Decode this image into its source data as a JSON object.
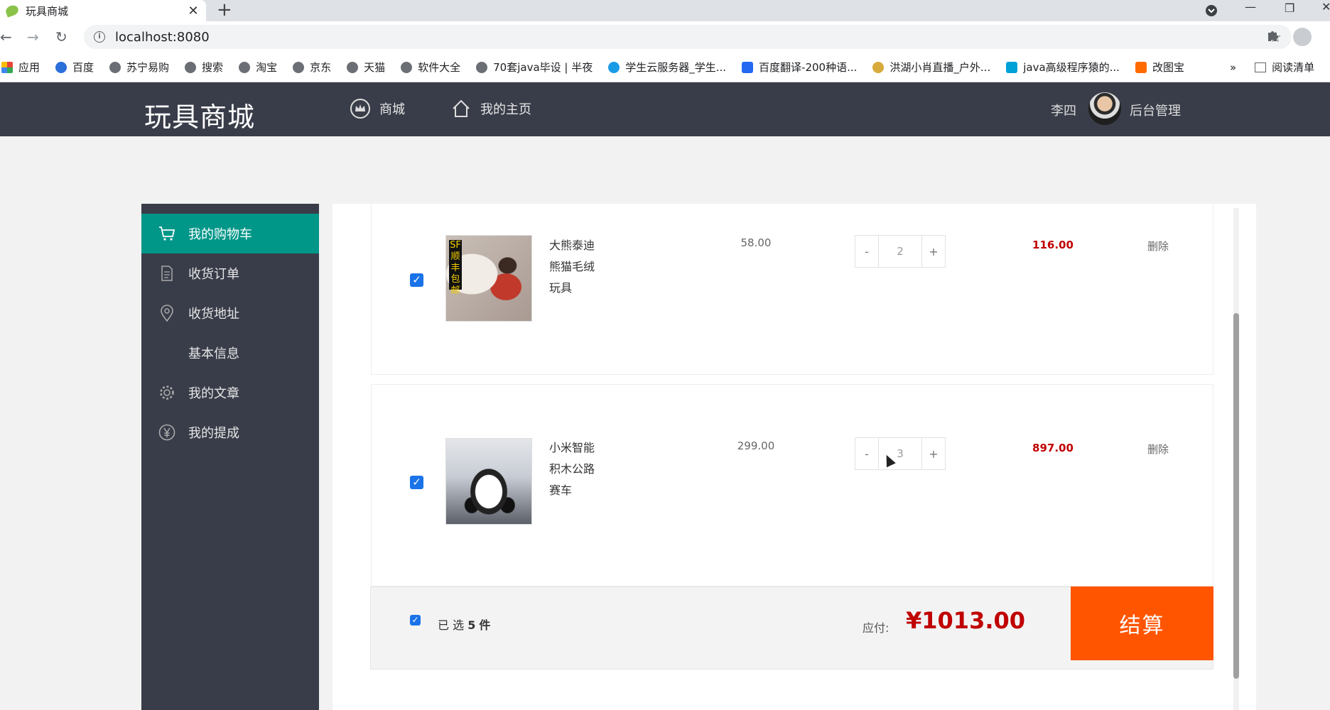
{
  "browser": {
    "tab_title": "玩具商城",
    "tab_close": "✕",
    "new_tab": "+",
    "url": "localhost:8080",
    "nav": {
      "back": "←",
      "forward": "→",
      "reload": "↻"
    },
    "star": "☆",
    "bookmarks": [
      {
        "label": "应用",
        "icon": "apps-grid-icon"
      },
      {
        "label": "百度",
        "icon": "baidu-paw-icon"
      },
      {
        "label": "苏宁易购",
        "icon": "globe-icon"
      },
      {
        "label": "搜索",
        "icon": "globe-icon"
      },
      {
        "label": "淘宝",
        "icon": "globe-icon"
      },
      {
        "label": "京东",
        "icon": "globe-icon"
      },
      {
        "label": "天猫",
        "icon": "globe-icon"
      },
      {
        "label": "软件大全",
        "icon": "globe-icon"
      },
      {
        "label": "70套java毕设 | 半夜",
        "icon": "globe-icon"
      },
      {
        "label": "学生云服务器_学生...",
        "icon": "cloud-icon"
      },
      {
        "label": "百度翻译-200种语...",
        "icon": "translate-icon"
      },
      {
        "label": "洪湖小肖直播_户外...",
        "icon": "feather-icon"
      },
      {
        "label": "java高级程序猿的...",
        "icon": "tv-icon"
      },
      {
        "label": "改图宝",
        "icon": "orange-square-icon"
      }
    ],
    "bookmarks_more": "»",
    "reading_list": "阅读清单"
  },
  "site": {
    "logo": "玩具商城",
    "nav": [
      {
        "label": "商城",
        "icon": "crown-icon"
      },
      {
        "label": "我的主页",
        "icon": "home-icon"
      }
    ],
    "user_name": "李四",
    "admin_link": "后台管理"
  },
  "side_menu": [
    {
      "label": "我的购物车",
      "icon": "cart-icon",
      "active": true
    },
    {
      "label": "收货订单",
      "icon": "document-icon"
    },
    {
      "label": "收货地址",
      "icon": "location-pin-icon"
    },
    {
      "label": "基本信息",
      "icon": ""
    },
    {
      "label": "我的文章",
      "icon": "gear-icon"
    },
    {
      "label": "我的提成",
      "icon": "yen-icon"
    }
  ],
  "cart": {
    "items": [
      {
        "name_lines": [
          "大熊泰迪",
          "熊猫毛绒",
          "玩具"
        ],
        "price": "58.00",
        "qty": "2",
        "subtotal": "116.00",
        "delete_label": "删除",
        "checked": true,
        "image": "teddy-bear-photo",
        "image_badge": "SF顺丰包邮"
      },
      {
        "name_lines": [
          "小米智能",
          "积木公路",
          "赛车"
        ],
        "price": "299.00",
        "qty": "3",
        "subtotal": "897.00",
        "delete_label": "删除",
        "checked": true,
        "image": "lego-race-car-photo"
      }
    ],
    "qty_minus": "-",
    "qty_plus": "+",
    "footer": {
      "selected_prefix": "已 选",
      "selected_count": "5",
      "selected_suffix": "件",
      "pay_label": "应付:",
      "total": "¥1013.00",
      "checkout_label": "结算"
    }
  },
  "colors": {
    "header_bg": "#393d49",
    "active_menu": "#009688",
    "price_red": "#c00000",
    "checkout_orange": "#ff5500"
  }
}
